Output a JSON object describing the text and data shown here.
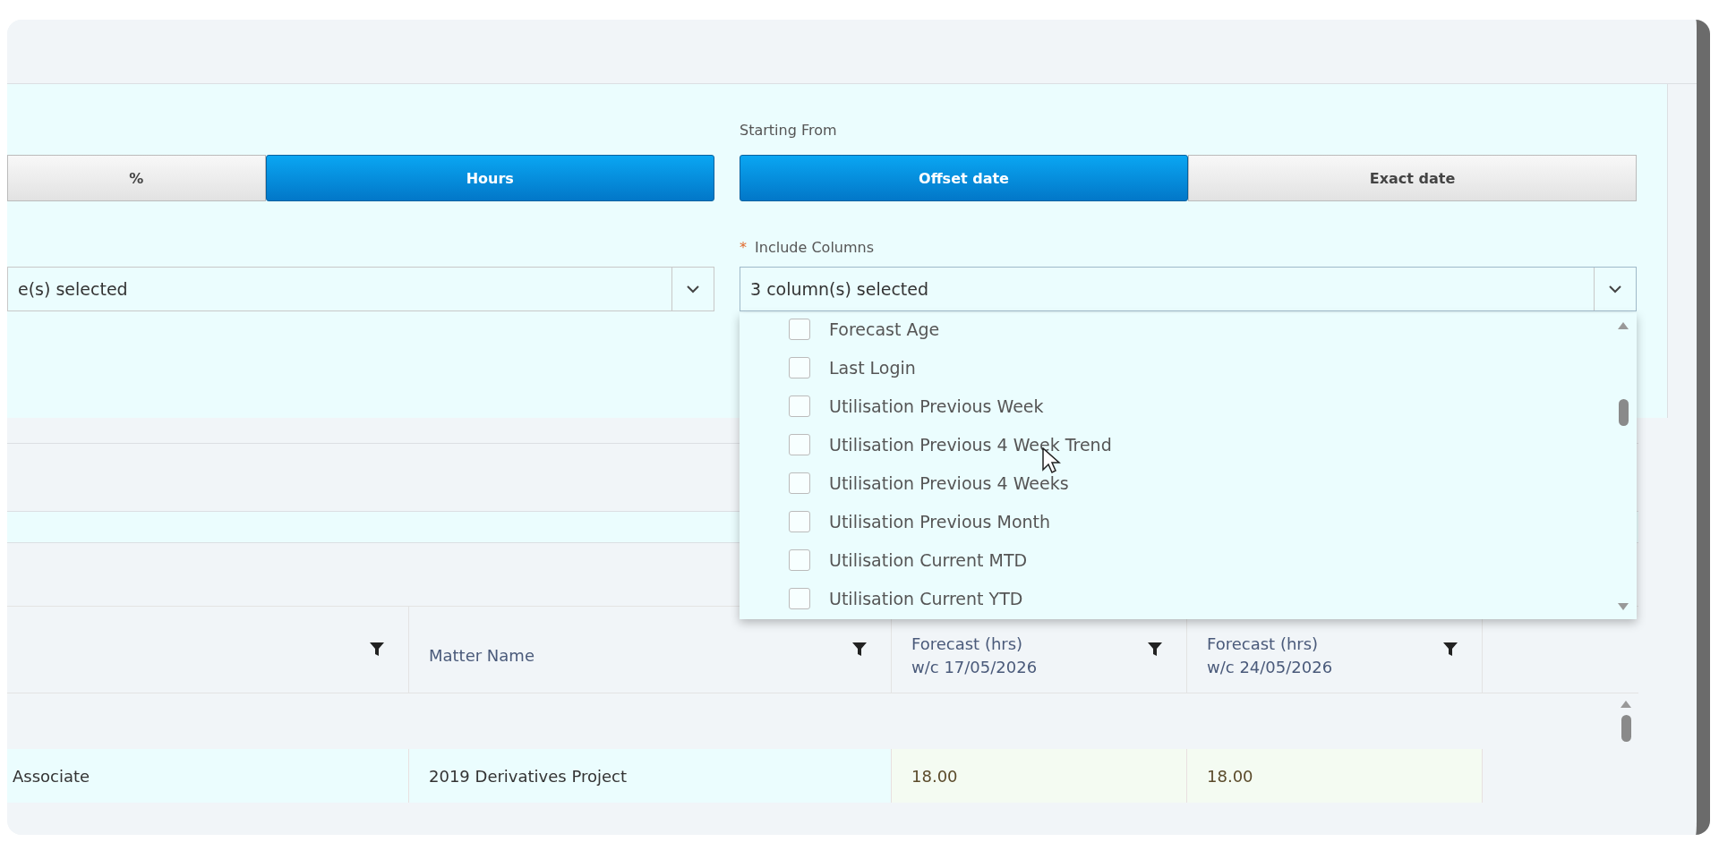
{
  "unit_toggle": [
    {
      "label": "%",
      "selected": false
    },
    {
      "label": "Hours",
      "selected": true
    }
  ],
  "left_select": {
    "value": "e(s) selected"
  },
  "starting_from": {
    "label": "Starting From",
    "options": [
      {
        "label": "Offset date",
        "selected": true
      },
      {
        "label": "Exact date",
        "selected": false
      }
    ]
  },
  "include_columns": {
    "required_mark": "*",
    "label": "Include Columns",
    "value": "3 column(s) selected",
    "expanded": true,
    "options": [
      {
        "label": "Forecast Age",
        "checked": false
      },
      {
        "label": "Last Login",
        "checked": false
      },
      {
        "label": "Utilisation Previous Week",
        "checked": false
      },
      {
        "label": "Utilisation Previous 4 Week Trend",
        "checked": false
      },
      {
        "label": "Utilisation Previous 4 Weeks",
        "checked": false
      },
      {
        "label": "Utilisation Previous Month",
        "checked": false
      },
      {
        "label": "Utilisation Current MTD",
        "checked": false
      },
      {
        "label": "Utilisation Current YTD",
        "checked": false
      }
    ]
  },
  "table": {
    "columns": [
      {
        "filterable": true
      },
      {
        "lines": [
          "Matter Name"
        ],
        "filterable": true
      },
      {
        "lines": [
          "Forecast (hrs)",
          "w/c 17/05/2026"
        ],
        "filterable": true
      },
      {
        "lines": [
          "Forecast (hrs)",
          "w/c 24/05/2026"
        ],
        "filterable": true
      }
    ],
    "rows": [
      [
        "Associate",
        "2019 Derivatives Project",
        "18.00",
        "18.00"
      ]
    ]
  }
}
